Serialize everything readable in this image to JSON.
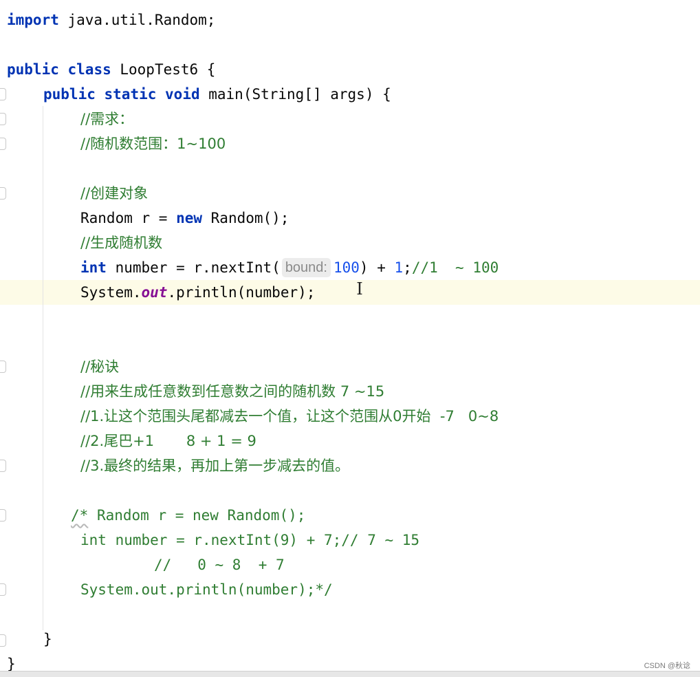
{
  "code": {
    "l1_kw": "import",
    "l1_rest": " java.util.Random;",
    "l3_kw1": "public",
    "l3_kw2": "class",
    "l3_rest": " LoopTest6 {",
    "l4_kw1": "public",
    "l4_kw2": "static",
    "l4_kw3": "void",
    "l4_rest": " main(String[] args) {",
    "c_need": "//需求：",
    "c_range": "//随机数范围：1~100",
    "c_create": "//创建对象",
    "l9_a": "Random r = ",
    "l9_kw": "new",
    "l9_b": " Random();",
    "c_gen": "//生成随机数",
    "l11_kw": "int",
    "l11_a": " number = r.nextInt(",
    "l11_hint": "bound:",
    "l11_num1": "100",
    "l11_b": ") + ",
    "l11_num2": "1",
    "l11_c": ";",
    "l11_comment": "//1  ~ 100",
    "l12_a": "System.",
    "l12_field": "out",
    "l12_b": ".println(number);",
    "c_secret": "//秘诀",
    "c_s1": "//用来生成任意数到任意数之间的随机数 7 ~15",
    "c_s2": "//1.让这个范围头尾都减去一个值，让这个范围从0开始  -7   0~8",
    "c_s3": "//2.尾巴+1       8 + 1 = 9",
    "c_s4": "//3.最终的结果，再加上第一步减去的值。",
    "b1_open": "/*",
    "b1_rest": " Random r = new Random();",
    "b2": "int number = r.nextInt(9) + 7;// 7 ~ 15",
    "b3": "//   0 ~ 8  + 7",
    "b4": "System.out.println(number);*/",
    "close_inner": "}",
    "close_outer": "}"
  },
  "watermark": "CSDN @秋谂"
}
